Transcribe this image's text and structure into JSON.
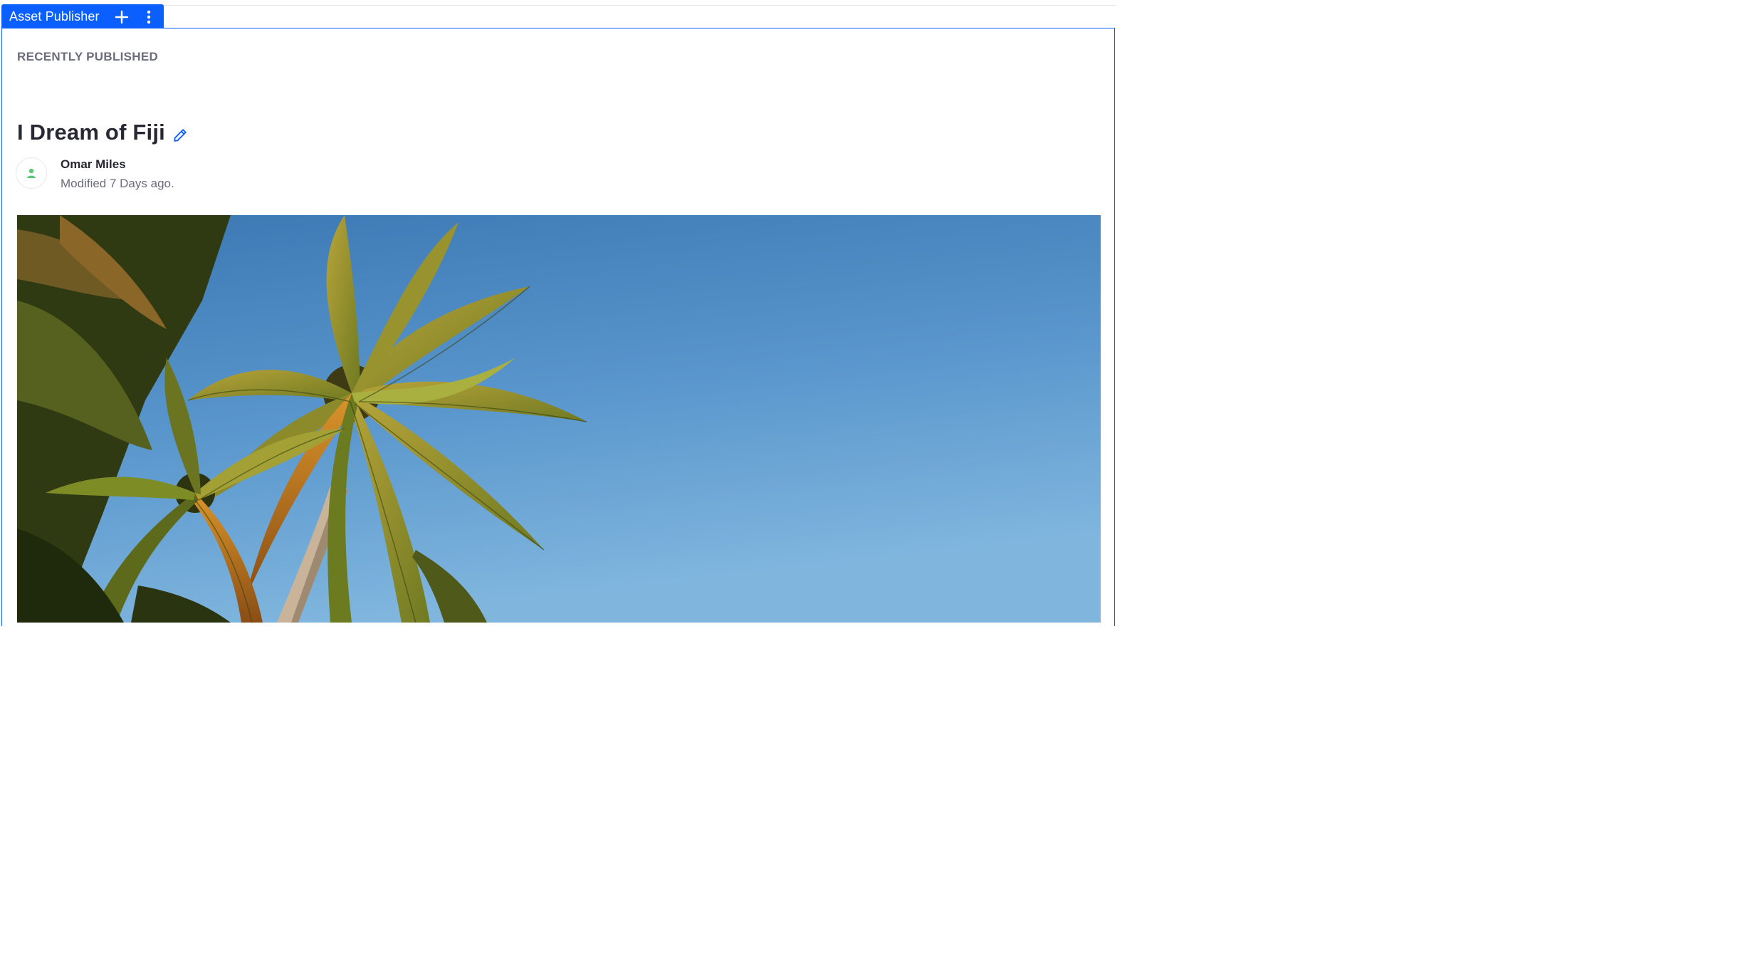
{
  "portlet": {
    "title": "Asset Publisher",
    "accent_color": "#0b5fff"
  },
  "section": {
    "title": "RECENTLY PUBLISHED"
  },
  "asset": {
    "title": "I Dream of Fiji",
    "author": "Omar Miles",
    "modified": "Modified 7 Days ago.",
    "image_subject": "palm trees against blue sky"
  },
  "icons": {
    "add": "plus-icon",
    "options": "kebab-vertical-icon",
    "edit": "pencil-icon",
    "avatar": "user-icon"
  }
}
